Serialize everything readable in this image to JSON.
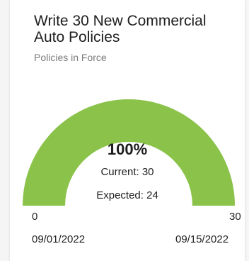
{
  "card": {
    "title": "Write 30 New Commercial Auto Policies",
    "subtitle": "Policies in Force"
  },
  "gauge": {
    "percent_text": "100%",
    "current_text": "Current: 30",
    "expected_text": "Expected: 24",
    "min_label": "0",
    "max_label": "30",
    "start_date": "09/01/2022",
    "end_date": "09/15/2022",
    "fill_fraction": 1.0,
    "fill_color": "#8bc34a"
  }
}
